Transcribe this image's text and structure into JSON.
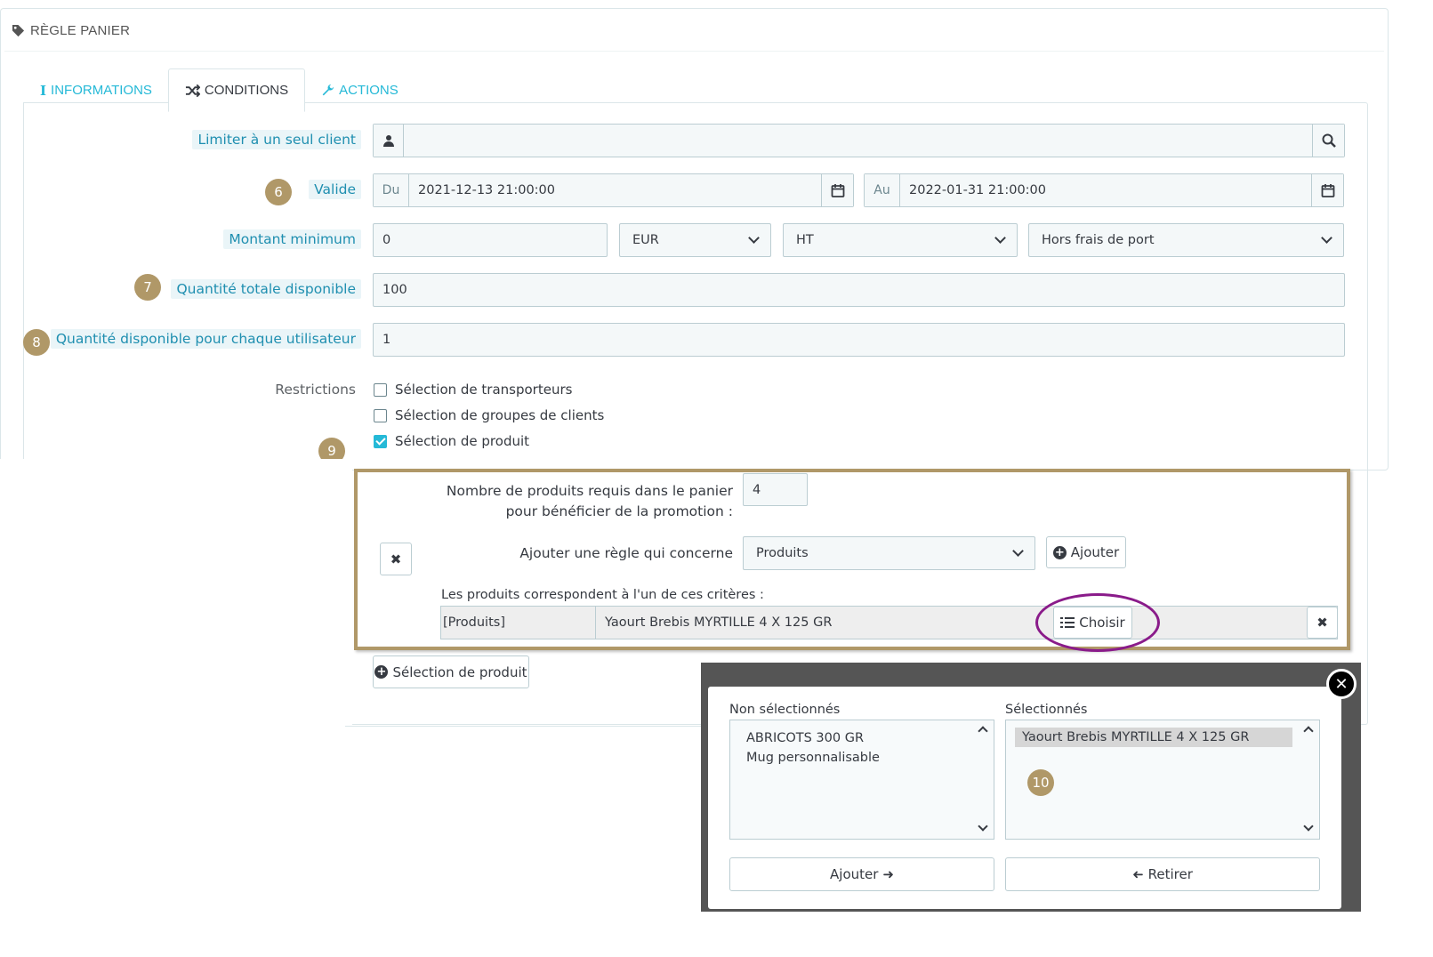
{
  "panel": {
    "title": "RÈGLE PANIER"
  },
  "tabs": [
    {
      "label": "INFORMATIONS",
      "icon": "info-icon"
    },
    {
      "label": "CONDITIONS",
      "icon": "shuffle-icon"
    },
    {
      "label": "ACTIONS",
      "icon": "wrench-icon"
    }
  ],
  "form": {
    "client_label": "Limiter à un seul client",
    "client_value": "",
    "valid_label": "Valide",
    "from_prefix": "Du",
    "from_value": "2021-12-13 21:00:00",
    "to_prefix": "Au",
    "to_value": "2022-01-31 21:00:00",
    "min_amount_label": "Montant minimum",
    "min_amount_value": "0",
    "currency": "EUR",
    "tax": "HT",
    "shipping": "Hors frais de port",
    "total_qty_label": "Quantité totale disponible",
    "total_qty_value": "100",
    "per_user_label": "Quantité disponible pour chaque utilisateur",
    "per_user_value": "1",
    "restrictions_label": "Restrictions",
    "restrictions": [
      {
        "label": "Sélection de transporteurs",
        "checked": false
      },
      {
        "label": "Sélection de groupes de clients",
        "checked": false
      },
      {
        "label": "Sélection de produit",
        "checked": true
      }
    ]
  },
  "rule": {
    "required_label_1": "Nombre de produits requis dans le panier",
    "required_label_2": "pour bénéficier de la promotion :",
    "required_value": "4",
    "add_rule_label": "Ajouter une règle qui concerne",
    "add_rule_select": "Produits",
    "add_button": "Ajouter",
    "criteria_label": "Les produits correspondent à l'un de ces critères :",
    "criteria_type": "[Produits]",
    "criteria_value": "Yaourt Brebis MYRTILLE 4 X 125 GR",
    "choose_button": "Choisir"
  },
  "product_selection_button": "Sélection de produit",
  "modal": {
    "unselected_title": "Non sélectionnés",
    "unselected_items": [
      "ABRICOTS 300 GR",
      "Mug personnalisable"
    ],
    "selected_title": "Sélectionnés",
    "selected_items": [
      "Yaourt Brebis MYRTILLE 4 X 125 GR"
    ],
    "add_button": "Ajouter",
    "remove_button": "Retirer"
  },
  "badges": [
    "6",
    "7",
    "8",
    "9",
    "10"
  ]
}
